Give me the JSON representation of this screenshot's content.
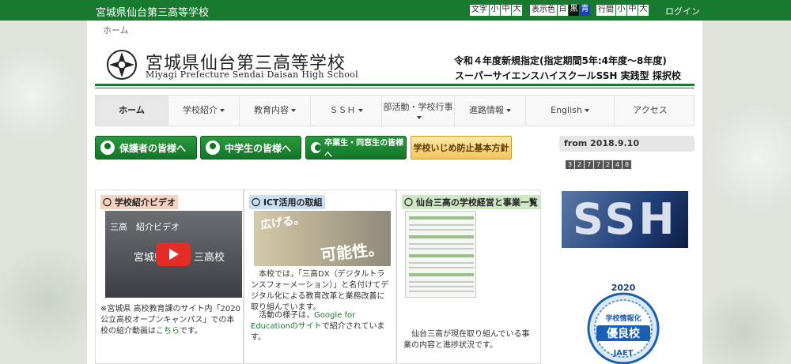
{
  "topbar": {
    "site_name": "宮城県仙台第三高等学校",
    "font_size": {
      "label": "文字",
      "options": [
        "小",
        "中",
        "大"
      ]
    },
    "color": {
      "label": "表示色",
      "options": [
        "白",
        "黒",
        "青"
      ]
    },
    "line_spacing": {
      "label": "行間",
      "options": [
        "小",
        "中",
        "大"
      ]
    },
    "login": "ログイン"
  },
  "breadcrumb": "ホーム",
  "header": {
    "title": "宮城県仙台第三高等学校",
    "subtitle": "Miyagi Prefecture Sendai Daisan High School",
    "ssh_line1": "令和４年度新規指定(指定期間5年:4年度～8年度)",
    "ssh_line2": "スーパーサイエンスハイスクールSSH 実践型 採択校"
  },
  "nav": [
    {
      "label": "ホーム",
      "caret": false,
      "active": true
    },
    {
      "label": "学校紹介",
      "caret": true
    },
    {
      "label": "教育内容",
      "caret": true
    },
    {
      "label": "ＳＳＨ",
      "caret": true
    },
    {
      "label": "部活動・学校行事",
      "caret": true
    },
    {
      "label": "進路情報",
      "caret": true
    },
    {
      "label": "English",
      "caret": true
    },
    {
      "label": "アクセス",
      "caret": false
    }
  ],
  "audience": {
    "parents": "保護者の皆様へ",
    "junior_high": "中学生の皆様へ",
    "alumni": "卒業生・同窓生の皆様へ",
    "anti_bullying": "学校いじめ防止基本方針"
  },
  "sidebar": {
    "from": "from 2018.9.10",
    "counter": [
      "3",
      "2",
      "7",
      "7",
      "2",
      "4",
      "8"
    ],
    "ssh_banner": "SSH",
    "badge_year": "2020",
    "badge_text": "学校情報化優良校",
    "badge_org": "JAET"
  },
  "boxes": {
    "video": {
      "heading": "〇 学校紹介ビデオ",
      "video_title": "三高　紹介ビデオ",
      "video_mid": "宮城県",
      "video_mid2": "三高校",
      "text": "※宮城県 高校教育課のサイト内「2020公立高校オープンキャンパス」での本校の紹介動画は",
      "link": "こちら",
      "text_end": "です。"
    },
    "ict": {
      "heading": "〇 ICT活用の取組",
      "img_word1": "広げる。",
      "img_word2": "可能性。",
      "para1": "本校では，「三高DX（デジタルトランスフォーメーション）」と名付けてデジタル化による教育改革と業務改善に取り組んでいます。",
      "para2_pre": "活動の様子は，",
      "para2_link": "Google for Educationのサイト",
      "para2_post": "で紹介されています。"
    },
    "management": {
      "heading": "〇 仙台三高の学校経営と事業一覧",
      "text": "仙台三高が現在取り組んでいる事業の内容と進捗状況です。"
    }
  },
  "colors": {
    "brand_green": "#187a2f",
    "anti_bullying_bg": "#f5c659"
  }
}
